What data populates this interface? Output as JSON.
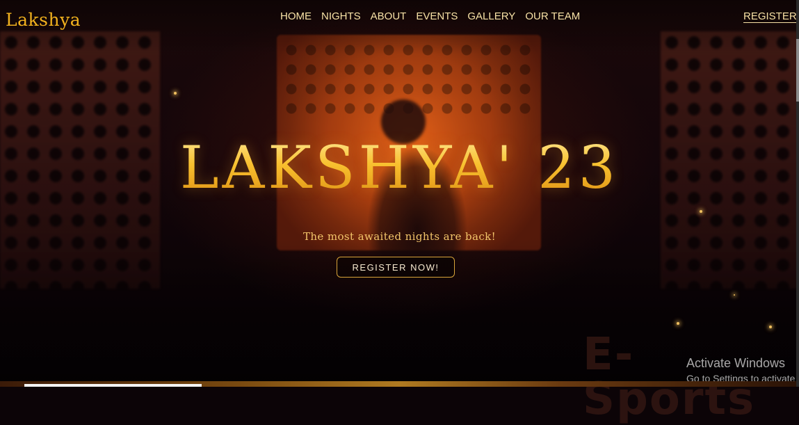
{
  "brand": "Lakshya",
  "nav": {
    "items": [
      "HOME",
      "NIGHTS",
      "ABOUT",
      "EVENTS",
      "GALLERY",
      "OUR TEAM"
    ],
    "register_label": "REGISTER"
  },
  "hero": {
    "title": "LAKSHYA' 23",
    "tagline": "The most awaited nights are back!",
    "cta_label": "REGISTER NOW!"
  },
  "watermark": "E-Sports",
  "os_overlay": {
    "line1": "Activate Windows",
    "line2": "Go to Settings to activate"
  },
  "colors": {
    "accent_gold": "#f2b21e",
    "nav_text": "#f7e2a6",
    "background": "#0c0407"
  }
}
